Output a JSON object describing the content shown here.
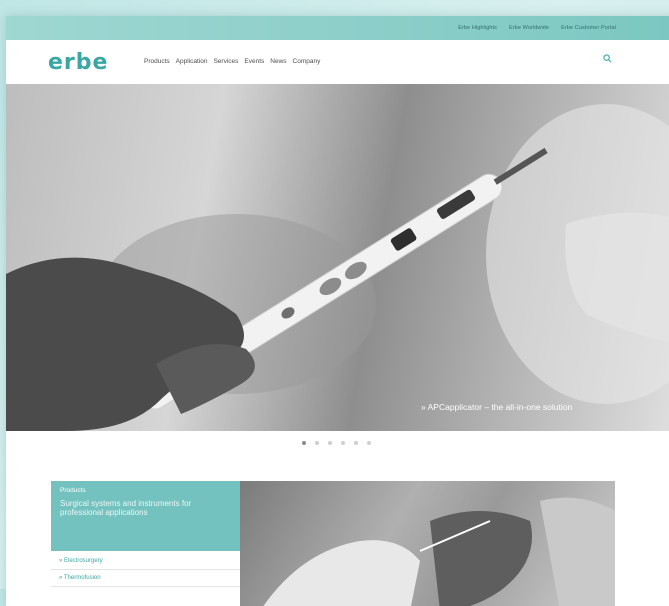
{
  "topbar": {
    "links": [
      "Erbe Highlights",
      "Erbe Worldwide",
      "Erbe Customer Portal"
    ]
  },
  "header": {
    "logo": "erbe",
    "menu": [
      "Products",
      "Application",
      "Services",
      "Events",
      "News",
      "Company"
    ]
  },
  "hero": {
    "caption": "» APCapplicator – the all-in-one solution"
  },
  "panel": {
    "title": "Products",
    "subtitle": "Surgical systems and instruments for professional applications"
  },
  "list": [
    "» Electrosurgery",
    "» Thermofusion"
  ],
  "colors": {
    "brand": "#3aa7a3",
    "panel": "#74c2bf",
    "topbar": "#9fd7d2"
  }
}
